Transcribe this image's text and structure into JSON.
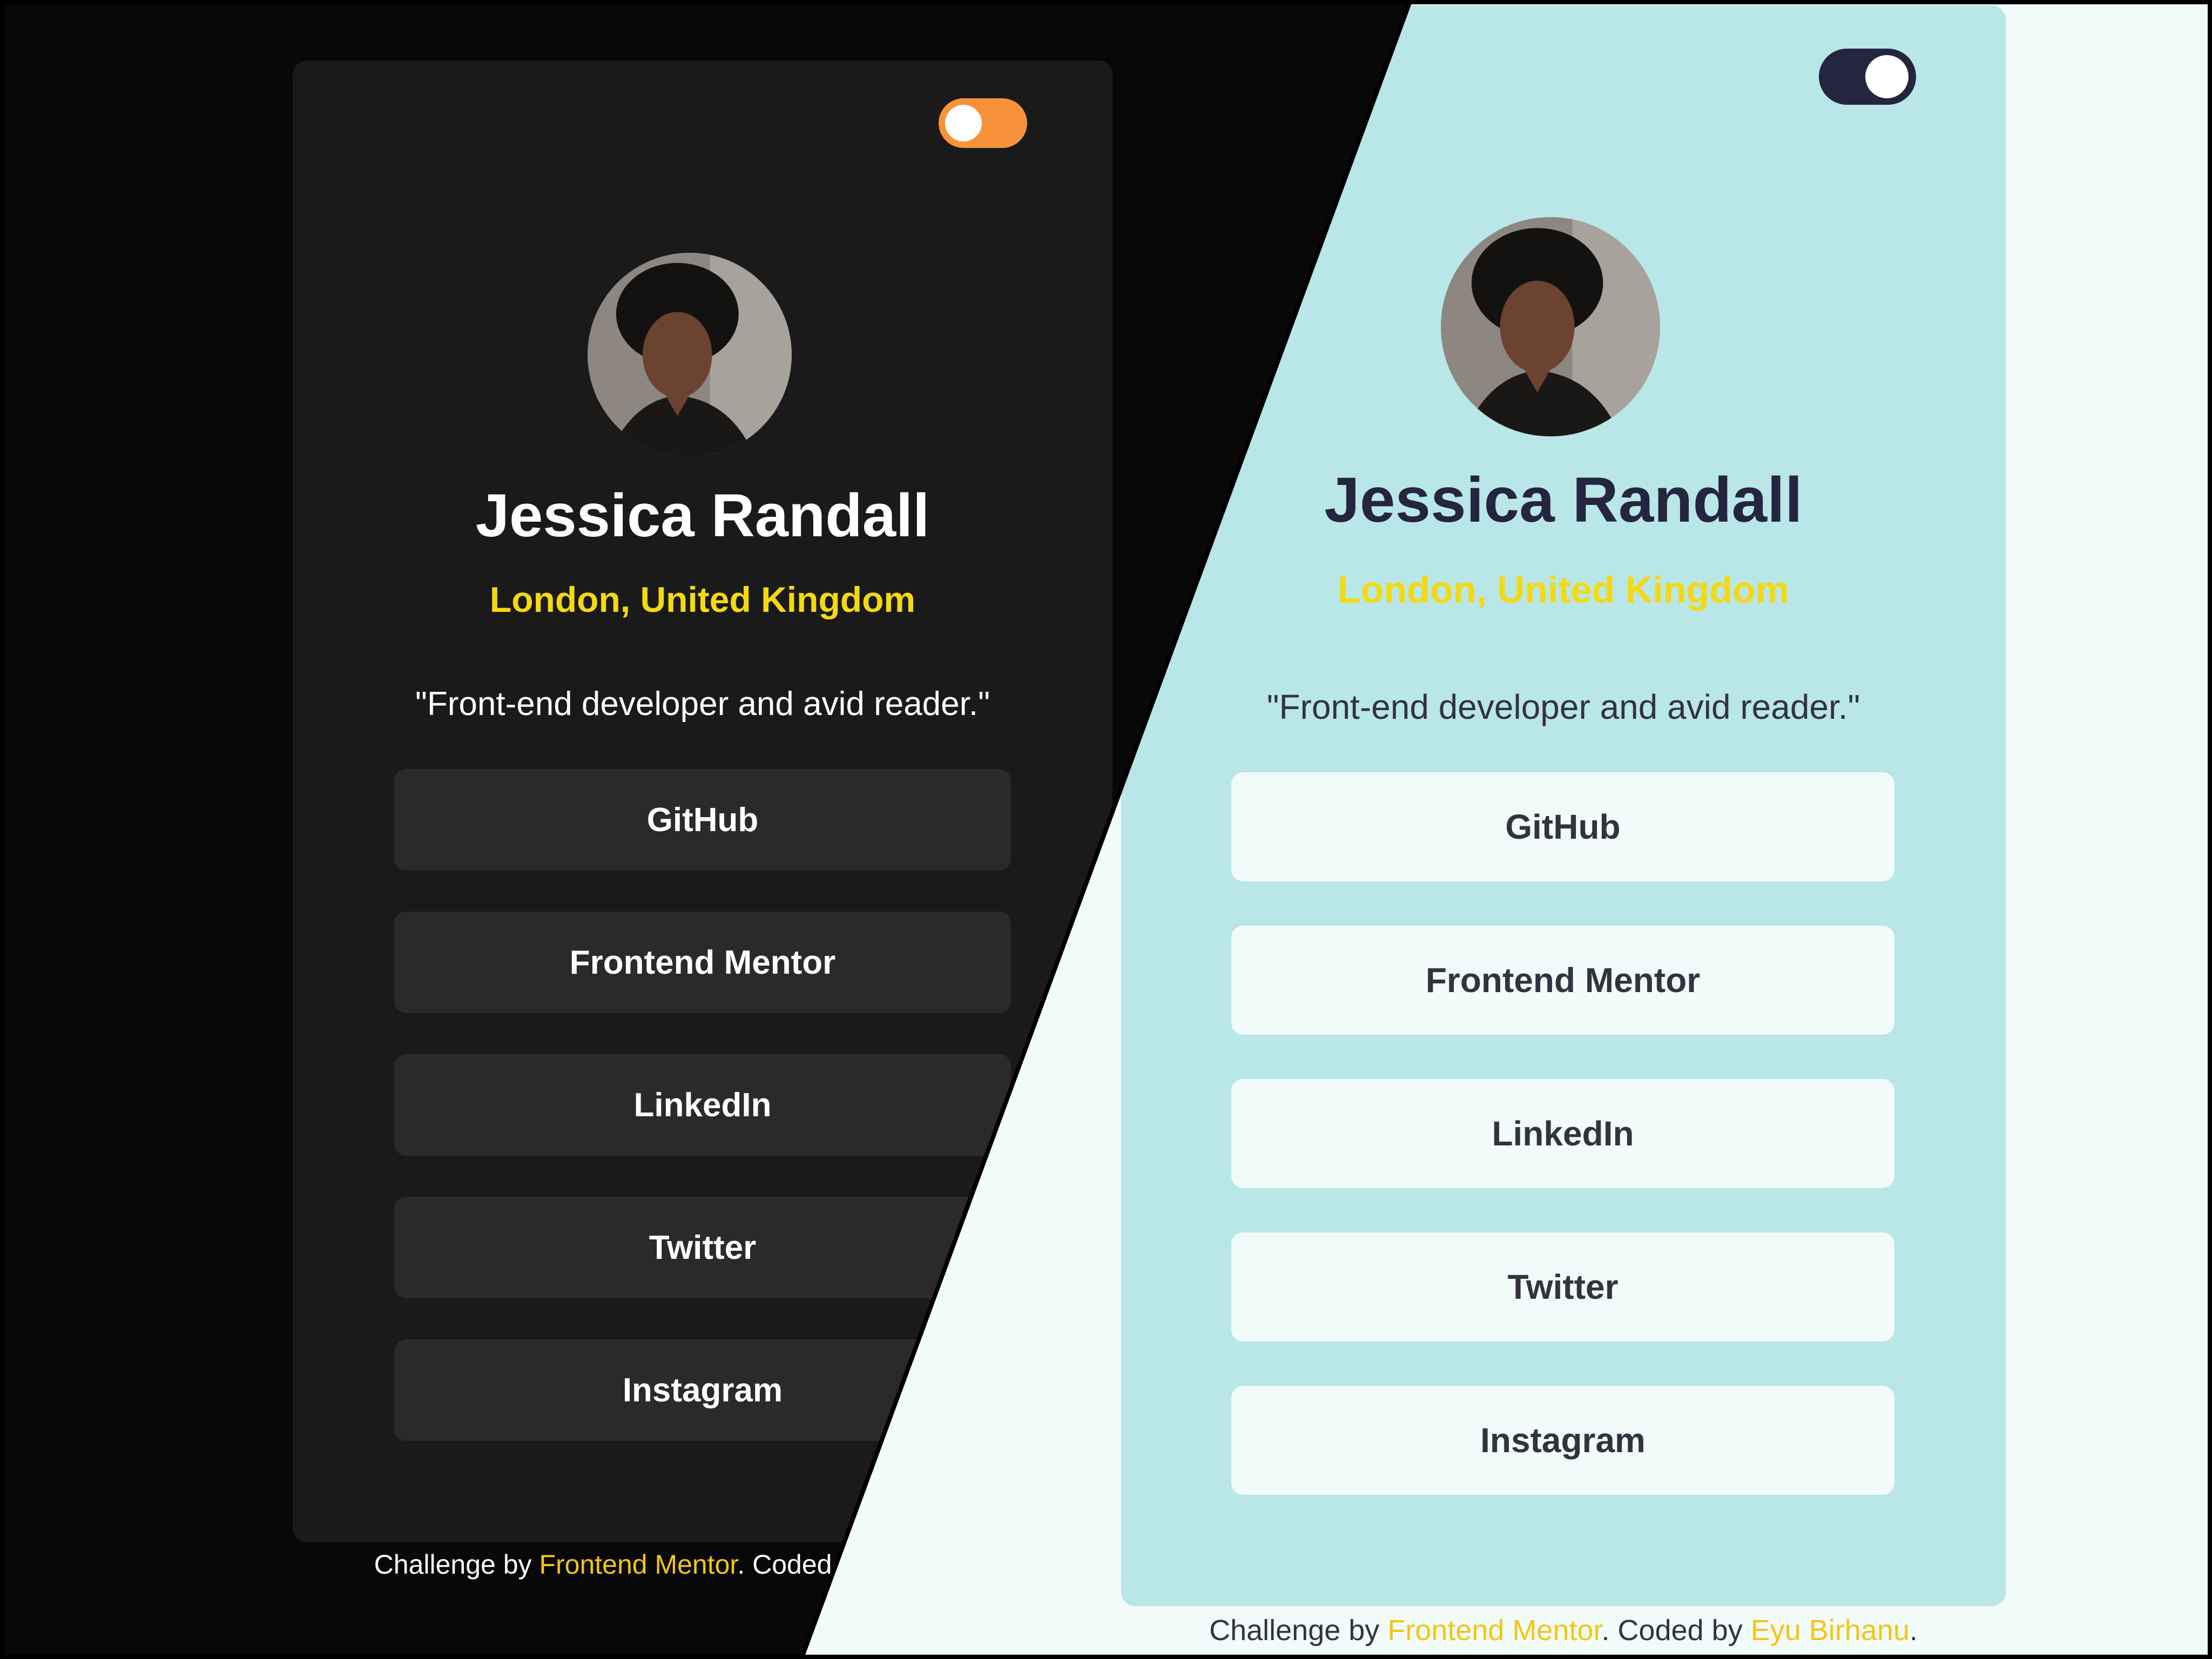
{
  "profile": {
    "name": "Jessica Randall",
    "location": "London, United Kingdom",
    "bio": "\"Front-end developer and avid reader.\""
  },
  "links": [
    {
      "label": "GitHub"
    },
    {
      "label": "Frontend Mentor"
    },
    {
      "label": "LinkedIn"
    },
    {
      "label": "Twitter"
    },
    {
      "label": "Instagram"
    }
  ],
  "footer": {
    "prefix": "Challenge by ",
    "challenge_link": "Frontend Mentor",
    "middle": ". Coded by ",
    "author_link": "Eyu Birhanu",
    "suffix": "."
  },
  "theme_toggle": {
    "dark_mode": {
      "state": "off",
      "color": "#f7923a"
    },
    "light_mode": {
      "state": "on",
      "color": "#252540"
    }
  },
  "colors": {
    "dark_bg": "#080808",
    "dark_card": "#1a1a1a",
    "dark_button": "#2a2a2a",
    "light_bg": "#f1fbf9",
    "light_card": "#b9e6e6",
    "light_button": "#f1fbf9",
    "accent_yellow": "#f5d90f",
    "light_name": "#252540"
  },
  "icons": {
    "toggle_knob": "circle-knob",
    "avatar": "profile-photo"
  }
}
